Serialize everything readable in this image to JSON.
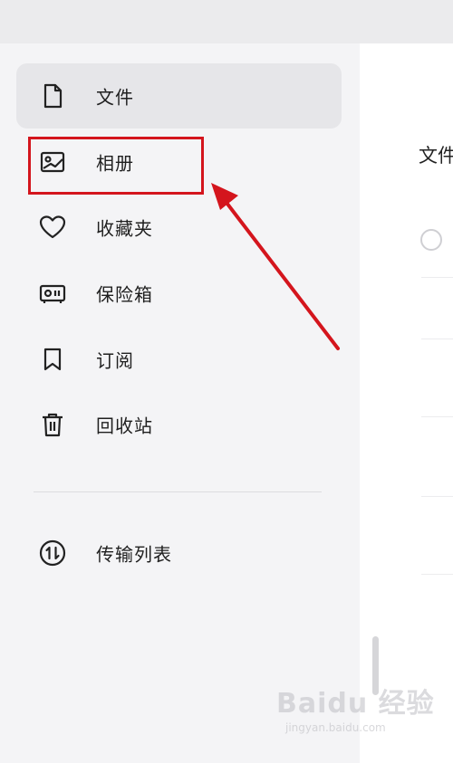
{
  "sidebar": {
    "items": [
      {
        "label": "文件",
        "icon": "file-icon",
        "active": true
      },
      {
        "label": "相册",
        "icon": "photo-album-icon",
        "active": false
      },
      {
        "label": "收藏夹",
        "icon": "heart-icon",
        "active": false
      },
      {
        "label": "保险箱",
        "icon": "safe-box-icon",
        "active": false
      },
      {
        "label": "订阅",
        "icon": "bookmark-icon",
        "active": false
      },
      {
        "label": "回收站",
        "icon": "trash-icon",
        "active": false
      }
    ],
    "transfer": {
      "label": "传输列表",
      "icon": "transfer-icon"
    }
  },
  "main": {
    "title": "文件"
  },
  "annotation": {
    "highlight_color": "#d4151d"
  },
  "watermark": {
    "text": "Baidu 经验",
    "sub": "jingyan.baidu.com"
  }
}
